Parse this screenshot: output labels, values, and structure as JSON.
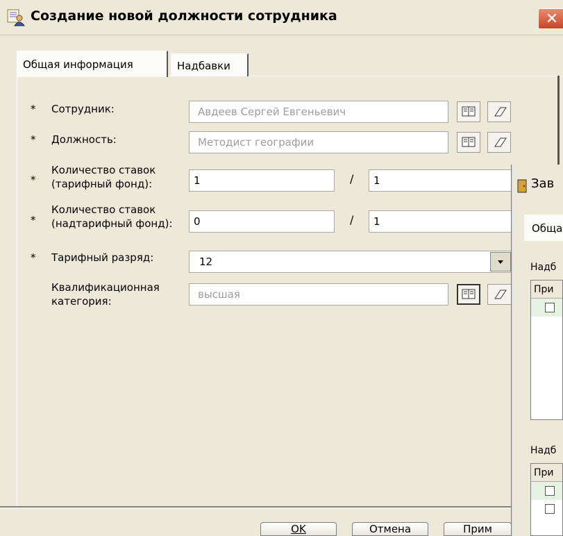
{
  "window": {
    "title": "Создание новой должности сотрудника",
    "close_glyph": "✕",
    "title_icon": "person-card-icon"
  },
  "tabs": [
    {
      "label": "Общая информация",
      "active": true
    },
    {
      "label": "Надбавки",
      "active": false
    }
  ],
  "form": {
    "required_mark": "*",
    "employee": {
      "label": "Сотрудник:",
      "value": "Авдеев Сергей Евгеньевич"
    },
    "position": {
      "label": "Должность:",
      "value": "Методист географии"
    },
    "rates_tariff": {
      "label_line1": "Количество ставок",
      "label_line2": "(тарифный фонд):",
      "value1": "1",
      "value2": "1"
    },
    "rates_over": {
      "label_line1": "Количество ставок",
      "label_line2": "(надтарифный фонд):",
      "value1": "0",
      "value2": "1"
    },
    "slash": "/",
    "tariff_grade": {
      "label": "Тарифный разряд:",
      "value": "12"
    },
    "qualification": {
      "label_line1": "Квалификационная",
      "label_line2": "категория:",
      "value": "высшая"
    }
  },
  "buttons": {
    "ok": "OK",
    "cancel": "Отмена",
    "apply": "Прим"
  },
  "second_window": {
    "title": "Зав",
    "tab": "Обща",
    "label1": "Надб",
    "col1": "При",
    "label2": "Надб",
    "col2": "При"
  },
  "colors": {
    "accent_close": "#c8452a",
    "readonly_text": "#9d9d9d"
  }
}
